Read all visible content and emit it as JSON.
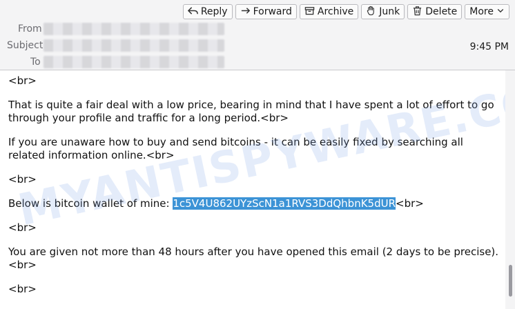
{
  "toolbar": {
    "reply": "Reply",
    "forward": "Forward",
    "archive": "Archive",
    "junk": "Junk",
    "delete": "Delete",
    "more": "More"
  },
  "headers": {
    "from_label": "From",
    "subject_label": "Subject",
    "to_label": "To",
    "time": "9:45 PM"
  },
  "body": {
    "line1": "<br>",
    "para1": "That is quite a fair deal with a low price, bearing in mind that I have spent a lot of effort to go through your profile and traffic for a long period.<br>",
    "para2": "If you are unaware how to buy and send bitcoins - it can be easily fixed by searching all related information online.<br>",
    "line2": "<br>",
    "wallet_prefix": "Below is bitcoin wallet of mine: ",
    "wallet_address": "1c5V4U862UYzScN1a1RVS3DdQhbnK5dUR",
    "wallet_suffix": "<br>",
    "line3": "<br>",
    "para3": "You are given not more than 48 hours after you have opened this email (2 days to be precise).<br>",
    "line4": "<br>"
  },
  "watermark": "MYANTISPYWARE.COM",
  "icons": [
    "reply-icon",
    "forward-icon",
    "archive-icon",
    "junk-icon",
    "delete-icon",
    "chevron-down-icon"
  ]
}
